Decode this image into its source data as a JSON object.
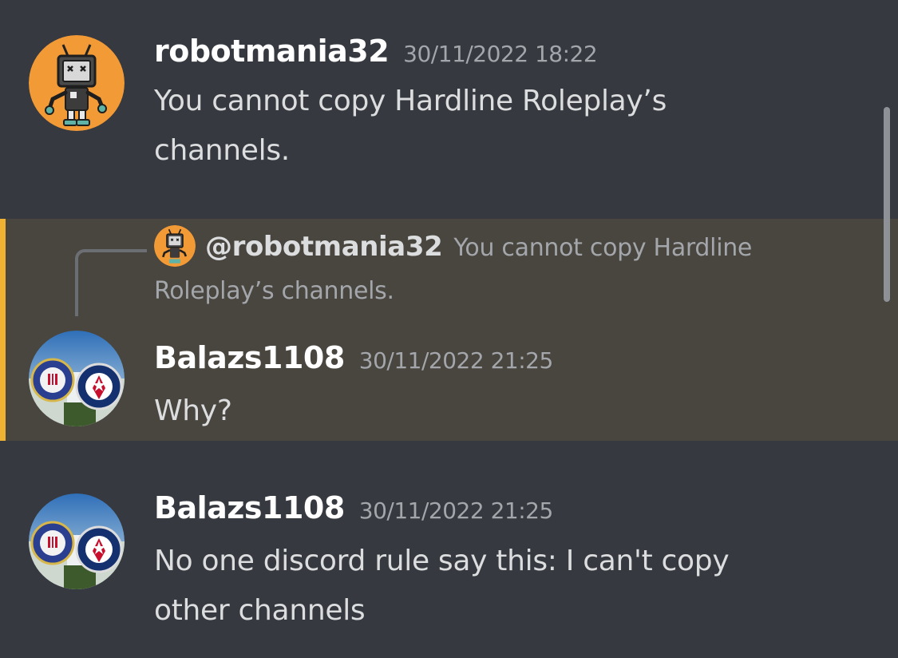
{
  "messages": [
    {
      "username": "robotmania32",
      "timestamp": "30/11/2022 18:22",
      "content": "You cannot copy Hardline Roleplay’s channels.",
      "avatar": "robot-avatar-icon"
    },
    {
      "username": "Balazs1108",
      "timestamp": "30/11/2022 21:25",
      "content": "Why?",
      "avatar": "agency-seals-avatar-icon",
      "reply": {
        "username": "@robotmania32",
        "content": "You cannot copy Hardline Roleplay’s channels.",
        "avatar": "robot-avatar-icon"
      }
    },
    {
      "username": "Balazs1108",
      "timestamp": "30/11/2022 21:25",
      "content": "No one discord rule say this: I can't copy other channels",
      "avatar": "agency-seals-avatar-icon"
    }
  ],
  "colors": {
    "background": "#36393f",
    "highlight": "#49453f",
    "highlight_bar": "#f0b232",
    "username": "#ffffff",
    "text": "#dcddde",
    "muted": "#a3a6aa"
  }
}
